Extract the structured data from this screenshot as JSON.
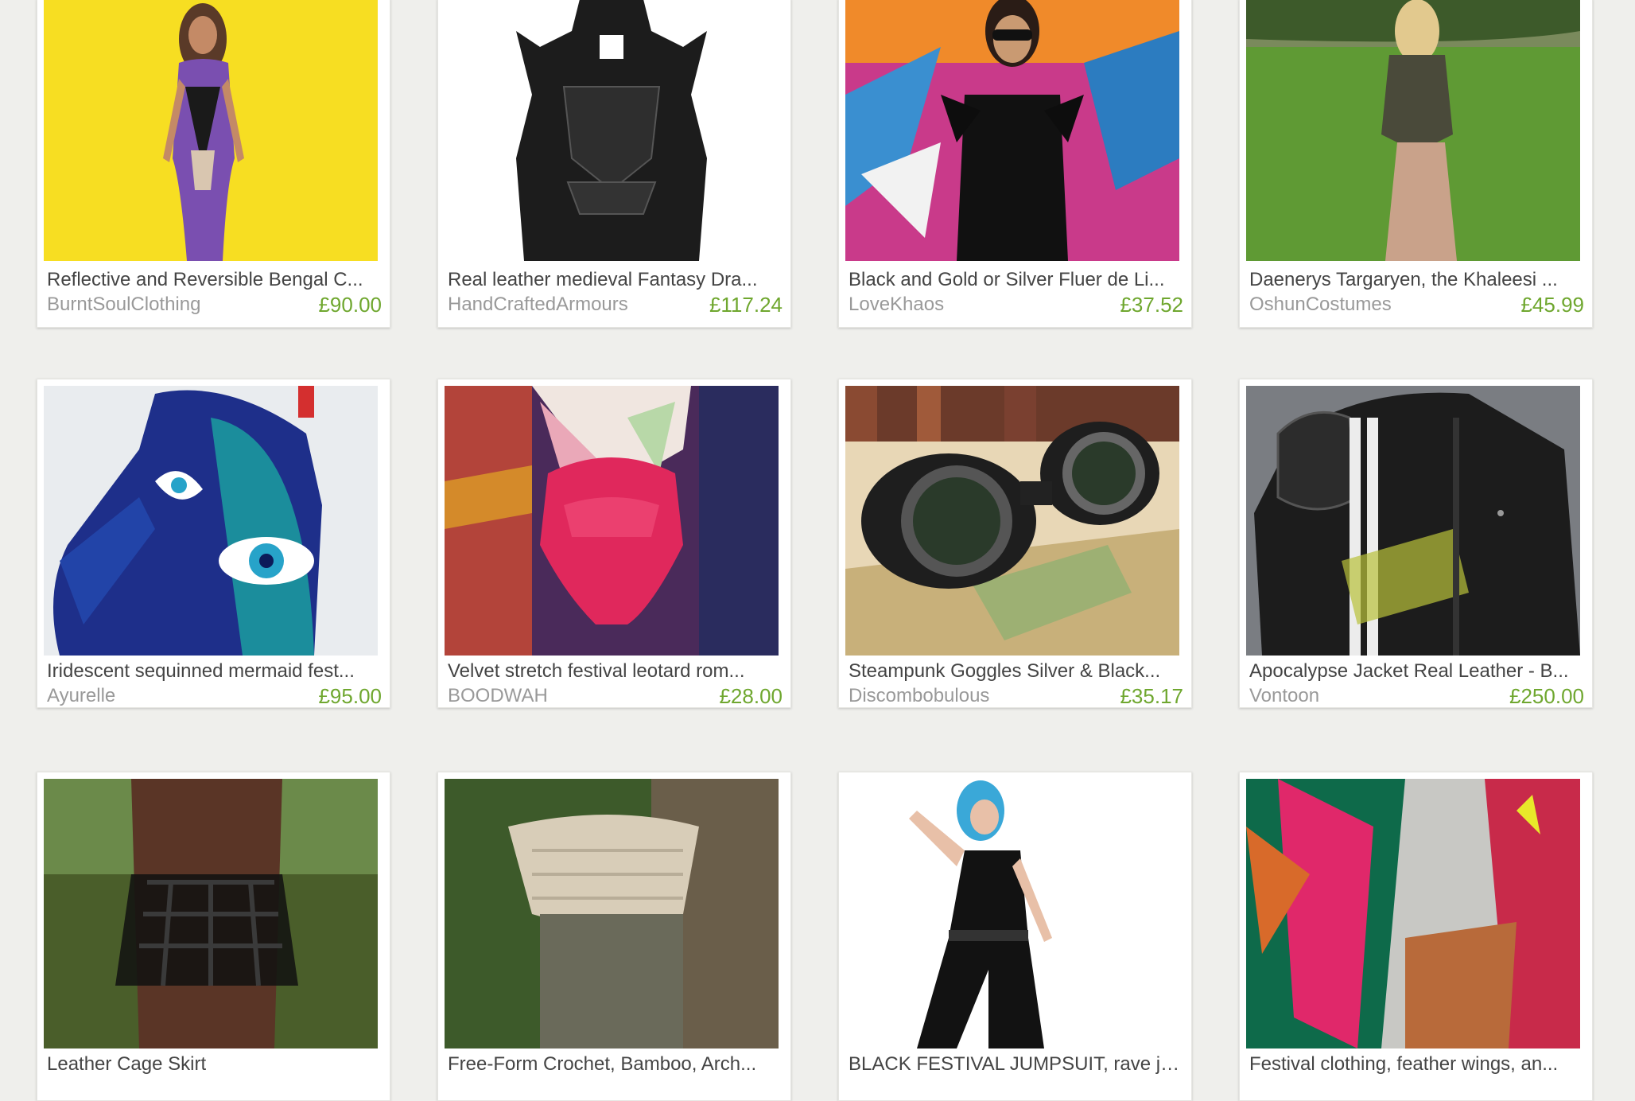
{
  "listings": [
    {
      "title": "Reflective and Reversible Bengal C...",
      "shop": "BurntSoulClothing",
      "price": "£90.00",
      "image": "yellow-backdrop-bodysuit"
    },
    {
      "title": "Real leather medieval Fantasy Dra...",
      "shop": "HandCraftedArmours",
      "price": "£117.24",
      "image": "black-leather-armor"
    },
    {
      "title": "Black and Gold or Silver Fluer de Li...",
      "shop": "LoveKhaos",
      "price": "£37.52",
      "image": "graffiti-wall-feather-epaulettes"
    },
    {
      "title": "Daenerys Targaryen, the Khaleesi ...",
      "shop": "OshunCostumes",
      "price": "£45.99",
      "image": "field-costume"
    },
    {
      "title": "Iridescent sequinned mermaid fest...",
      "shop": "Ayurelle",
      "price": "£95.00",
      "image": "sequin-eye-jacket"
    },
    {
      "title": "Velvet stretch festival leotard rom...",
      "shop": "BOODWAH",
      "price": "£28.00",
      "image": "pink-velvet-leotard"
    },
    {
      "title": "Steampunk Goggles Silver & Black...",
      "shop": "Discombobulous",
      "price": "£35.17",
      "image": "steampunk-goggles"
    },
    {
      "title": "Apocalypse Jacket Real Leather - B...",
      "shop": "Vontoon",
      "price": "£250.00",
      "image": "leather-jacket"
    },
    {
      "title": "Leather Cage Skirt",
      "shop": "",
      "price": "",
      "image": "cage-skirt"
    },
    {
      "title": "Free-Form Crochet, Bamboo, Arch...",
      "shop": "",
      "price": "",
      "image": "crochet-cowl"
    },
    {
      "title": "BLACK FESTIVAL JUMPSUIT, rave ju...",
      "shop": "",
      "price": "",
      "image": "black-jumpsuit"
    },
    {
      "title": "Festival clothing, feather wings, an...",
      "shop": "",
      "price": "",
      "image": "feather-wings"
    }
  ],
  "colors": {
    "background": "#efefec",
    "price": "#6fa72f",
    "title": "#444444",
    "shop": "#999999"
  }
}
